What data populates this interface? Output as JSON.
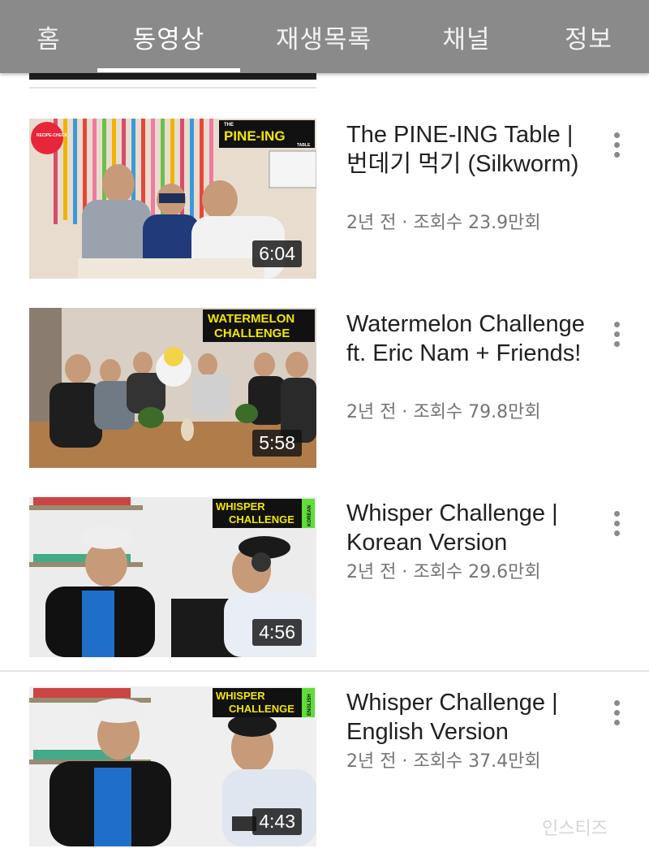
{
  "tabs": [
    {
      "label": "홈"
    },
    {
      "label": "동영상"
    },
    {
      "label": "재생목록"
    },
    {
      "label": "채널"
    },
    {
      "label": "정보"
    }
  ],
  "active_tab": "동영상",
  "videos": [
    {
      "title": "The PINE-ING Table | 번데기 먹기 (Silkworm)",
      "meta": "2년 전 · 조회수 23.9만회",
      "duration": "6:04",
      "thumb_badge": "PINE-ING",
      "thumb_badge_small": "THE",
      "thumb_badge_tail": "TABLE",
      "thumb_corner_text": "RECIPE-CHECK"
    },
    {
      "title": "Watermelon Challenge ft. Eric Nam + Friends!",
      "meta": "2년 전 · 조회수 79.8만회",
      "duration": "5:58",
      "thumb_badge_line1": "WATERMELON",
      "thumb_badge_line2": "CHALLENGE"
    },
    {
      "title": "Whisper Challenge | Korean Version",
      "meta": "2년 전 · 조회수 29.6만회",
      "duration": "4:56",
      "thumb_badge_line1": "WHISPER",
      "thumb_badge_line2": "CHALLENGE",
      "thumb_badge_side": "KOREAN"
    },
    {
      "title": "Whisper Challenge | English Version",
      "meta": "2년 전 · 조회수 37.4만회",
      "duration": "4:43",
      "thumb_badge_line1": "WHISPER",
      "thumb_badge_line2": "CHALLENGE",
      "thumb_badge_side": "ENGLISH"
    }
  ],
  "watermark": "인스티즈",
  "colors": {
    "tabbar": "#8a8a8a",
    "meta_text": "#757575",
    "title_text": "#212121",
    "badge_yellow": "#f2e600",
    "badge_green": "#5fdc3a"
  },
  "icons": {
    "menu": "more-vertical-icon"
  }
}
